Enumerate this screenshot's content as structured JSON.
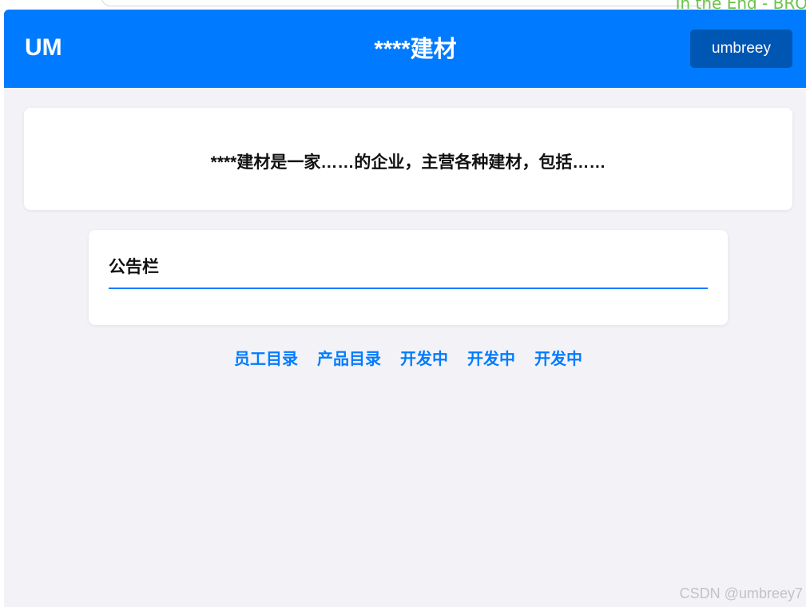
{
  "browser": {
    "overlay_text": "In the End - BRO"
  },
  "header": {
    "logo": "UM",
    "title": "****建材",
    "user_button": "umbreey"
  },
  "intro": {
    "text": "****建材是一家……的企业，主营各种建材，包括……"
  },
  "board": {
    "title": "公告栏"
  },
  "nav": {
    "links": [
      "员工目录",
      "产品目录",
      "开发中",
      "开发中",
      "开发中"
    ]
  },
  "watermark": "CSDN @umbreey7",
  "colors": {
    "primary": "#007bff",
    "primary_dark": "#0056b3",
    "background": "#f3f3f7",
    "overlay_green": "#6cc24a"
  }
}
